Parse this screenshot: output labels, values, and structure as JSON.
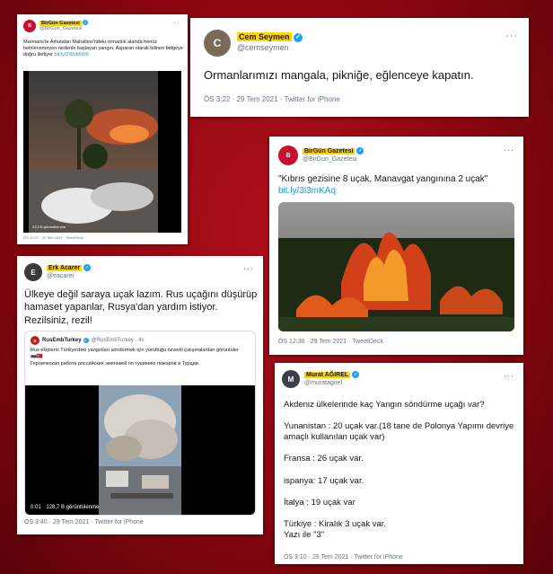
{
  "colors": {
    "background": "#9a0a14",
    "highlight": "#ffd400",
    "verified": "#1da1f2",
    "link": "#1b95e0"
  },
  "tweet_birgun_marmaris": {
    "name": "BirGün Gazetesi",
    "handle": "@BirGun_Gazetesi",
    "text": "Marmaris'te Amutalan Mahallesi'ndeki ormanlık alanda henüz belirlenemeyen nedenle başlayan yangın, Asparan olarak bilinen bölgeye doğru ilerliyor",
    "link": "bit.ly/2Wob6W6",
    "video_views": "23,3 B görüntülenme",
    "footer": "ÖS 12:27 · 29 Tem 2021 · TweetDeck"
  },
  "tweet_cem": {
    "name": "Cem Seymen",
    "handle": "@cemseymen",
    "text": "Ormanlarımızı mangala, pikniğe, eğlenceye kapatın.",
    "footer": "ÖS 3:22 · 29 Tem 2021 · Twitter for iPhone"
  },
  "tweet_birgun_kibris": {
    "name": "BirGün Gazetesi",
    "handle": "@BirGun_Gazetesi",
    "text": "\"Kıbrıs gezisine 8 uçak, Manavgat yangınına 2 uçak\"",
    "link": "bit.ly/3l3mKAq",
    "footer": "ÖS 12:36 · 29 Tem 2021 · TweetDeck"
  },
  "tweet_erk": {
    "name": "Erk Acarer",
    "handle": "@eacarer",
    "text": "Ülkeye değil saraya uçak lazım. Rus uçağını düşürüp hamaset yapanlar, Rusya'dan yardım istiyor. Rezilsiniz, rezil!",
    "quote_name": "RusEmbTurkey",
    "quote_handle": "@RusEmbTurkey · 4s",
    "quote_text_tr": "Rus ekiplerin Türkiye'deki yangınları söndürmek için yürüttüğü özverili çalışmalardan görüntüler",
    "quote_text_ru": "Героическая работа российских экипажей по тушению пожаров в Турции",
    "video_time": "0:01",
    "video_views": "128,7 B görüntülenme",
    "footer": "ÖS 3:40 · 29 Tem 2021 · Twitter for iPhone"
  },
  "tweet_murat": {
    "name": "Murat AĞIREL",
    "handle": "@muratagirel",
    "lines": [
      "Akdeniz ülkelerinde kaç Yangın söndürme uçağı var?",
      "Yunanistan : 20 uçak var.(18 tane de Polonya Yapımı devriye amaçlı kullanılan uçak var)",
      "Fransa : 26 uçak var.",
      "ispanya: 17 uçak var.",
      "İtalya : 19 uçak var",
      "Türkiye : Kiralık 3 uçak var.",
      "Yazı ile \"3\""
    ],
    "footer": "ÖS 3:10 · 29 Tem 2021 · Twitter for iPhone"
  },
  "icons": {
    "verified": "✓",
    "more": "···",
    "flag_ru": "🇷🇺",
    "flag_tr": "🇹🇷"
  }
}
